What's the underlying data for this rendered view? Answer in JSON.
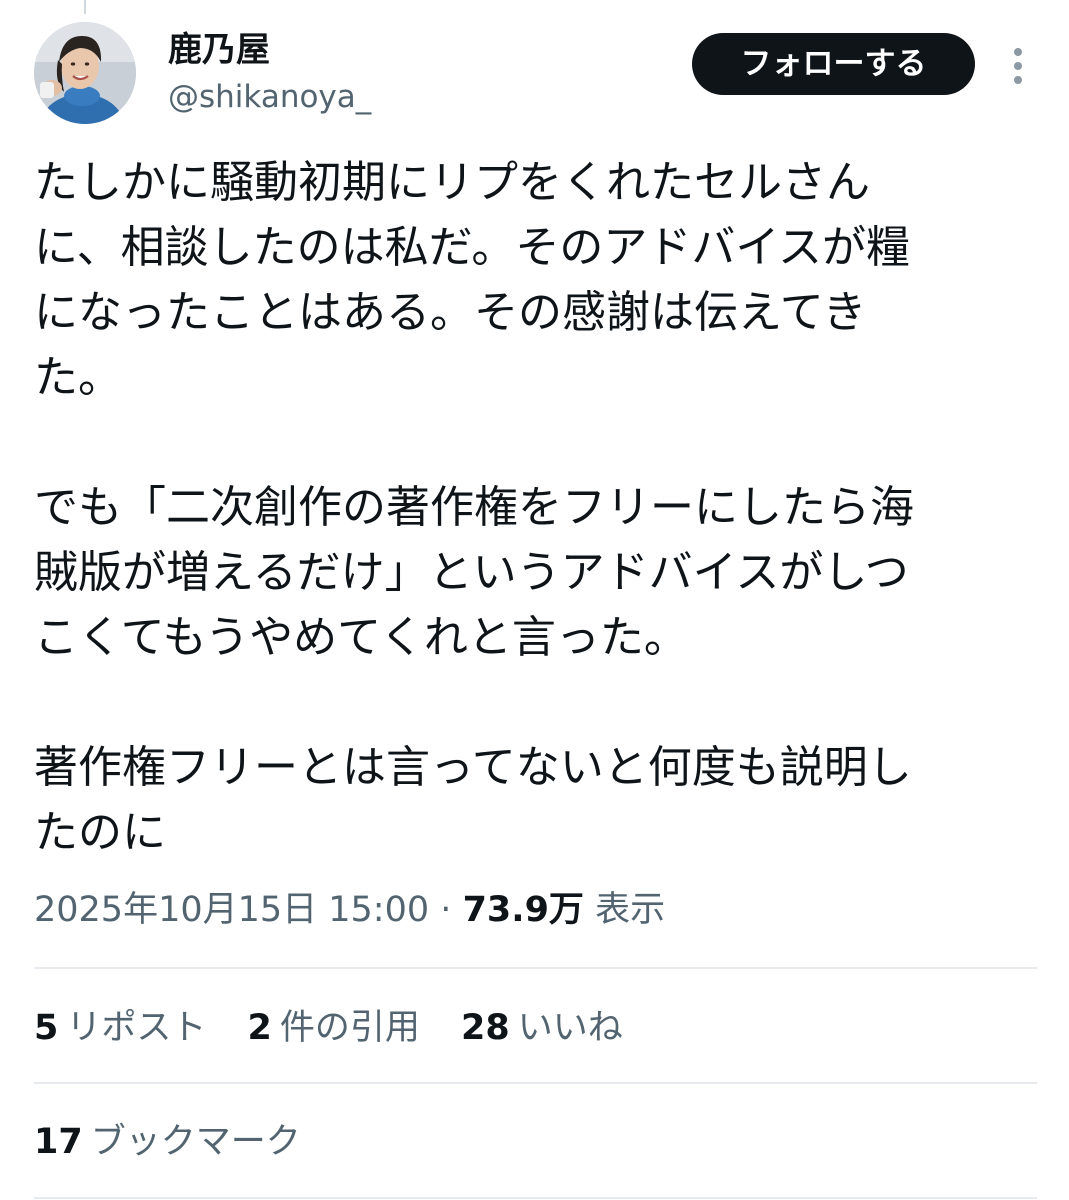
{
  "author": {
    "display_name": "鹿乃屋",
    "handle": "@shikanoya_",
    "avatar_icon": "profile-photo-avatar"
  },
  "actions": {
    "follow_label": "フォローする",
    "more_icon": "vertical-ellipsis-icon"
  },
  "tweet": {
    "paragraphs": [
      "たしかに騒動初期にリプをくれたセルさん\nに、相談したのは私だ。そのアドバイスが糧\nになったことはある。その感謝は伝えてき\nた。",
      "でも「二次創作の著作権をフリーにしたら海\n賊版が増えるだけ」というアドバイスがしつ\nこくてもうやめてくれと言った。",
      "著作権フリーとは言ってないと何度も説明し\nたのに"
    ]
  },
  "meta": {
    "timestamp": "2025年10月15日 15:00",
    "separator": "·",
    "views_count": "73.9万",
    "views_label": "表示"
  },
  "stats": {
    "reposts": {
      "count": "5",
      "label": "リポスト"
    },
    "quotes": {
      "count": "2",
      "label": "件の引用"
    },
    "likes": {
      "count": "28",
      "label": "いいね"
    },
    "bookmarks": {
      "count": "17",
      "label": "ブックマーク"
    }
  },
  "colors": {
    "text_primary": "#0f1419",
    "text_secondary": "#536471",
    "button_background": "#0f1419",
    "button_text": "#ffffff",
    "divider": "#e7eaee"
  }
}
